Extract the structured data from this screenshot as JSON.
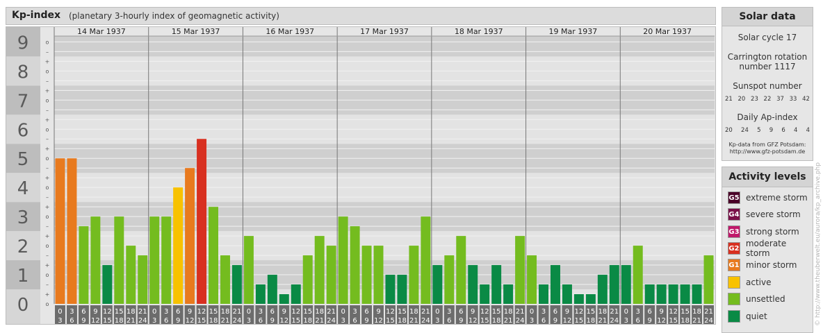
{
  "header": {
    "title": "Kp-index",
    "subtitle": "(planetary 3-hourly index of geomagnetic activity)"
  },
  "chart_data": {
    "type": "bar",
    "ylim": [
      0,
      9
    ],
    "y_ticks": [
      "0",
      "1",
      "2",
      "3",
      "4",
      "5",
      "6",
      "7",
      "8",
      "9"
    ],
    "minor_ticks": [
      "–",
      "o",
      "+"
    ],
    "days": [
      "14 Mar 1937",
      "15 Mar 1937",
      "16 Mar 1937",
      "17 Mar 1937",
      "18 Mar 1937",
      "19 Mar 1937",
      "20 Mar 1937"
    ],
    "interval_start": [
      "0",
      "3",
      "6",
      "9",
      "12",
      "15",
      "18",
      "21"
    ],
    "interval_end": [
      "3",
      "6",
      "9",
      "12",
      "15",
      "18",
      "21",
      "24"
    ],
    "values": [
      5.0,
      5.0,
      2.667,
      3.0,
      1.333,
      3.0,
      2.0,
      1.667,
      3.0,
      3.0,
      4.0,
      4.667,
      5.667,
      3.333,
      1.667,
      1.333,
      2.333,
      0.667,
      1.0,
      0.333,
      0.667,
      1.667,
      2.333,
      2.0,
      3.0,
      2.667,
      2.0,
      2.0,
      1.0,
      1.0,
      2.0,
      3.0,
      1.333,
      1.667,
      2.333,
      1.333,
      0.667,
      1.333,
      0.667,
      2.333,
      1.667,
      0.667,
      1.333,
      0.667,
      0.333,
      0.333,
      1.0,
      1.333,
      1.333,
      2.0,
      0.667,
      0.667,
      0.667,
      0.667,
      0.667,
      1.667
    ]
  },
  "colors": {
    "quiet": "#0a8a45",
    "unsettled": "#74bc1f",
    "active": "#f8c200",
    "minor_storm": "#e87a1e",
    "moderate_storm": "#d83020",
    "strong_storm": "#c0186a",
    "severe_storm": "#7a1048",
    "extreme_storm": "#4a0028"
  },
  "solar": {
    "title": "Solar data",
    "cycle": "Solar cycle 17",
    "carrington_1": "Carrington rotation",
    "carrington_2": "number 1117",
    "sunspot_title": "Sunspot number",
    "sunspot": [
      "21",
      "20",
      "23",
      "22",
      "37",
      "33",
      "42"
    ],
    "ap_title": "Daily Ap-index",
    "ap": [
      "20",
      "24",
      "5",
      "9",
      "6",
      "4",
      "4"
    ],
    "credit_1": "Kp-data from GFZ Potsdam:",
    "credit_2": "http://www.gfz-potsdam.de"
  },
  "levels": {
    "title": "Activity levels",
    "items": [
      {
        "code": "G5",
        "label": "extreme storm",
        "color": "#4a0028"
      },
      {
        "code": "G4",
        "label": "severe storm",
        "color": "#7a1048"
      },
      {
        "code": "G3",
        "label": "strong storm",
        "color": "#c0186a"
      },
      {
        "code": "G2",
        "label": "moderate storm",
        "color": "#d83020"
      },
      {
        "code": "G1",
        "label": "minor storm",
        "color": "#e87a1e"
      },
      {
        "code": "",
        "label": "active",
        "color": "#f8c200"
      },
      {
        "code": "",
        "label": "unsettled",
        "color": "#74bc1f"
      },
      {
        "code": "",
        "label": "quiet",
        "color": "#0a8a45"
      }
    ]
  },
  "watermark": "© http://www.theuberwelt.eu/aurora/kp_archive.php"
}
